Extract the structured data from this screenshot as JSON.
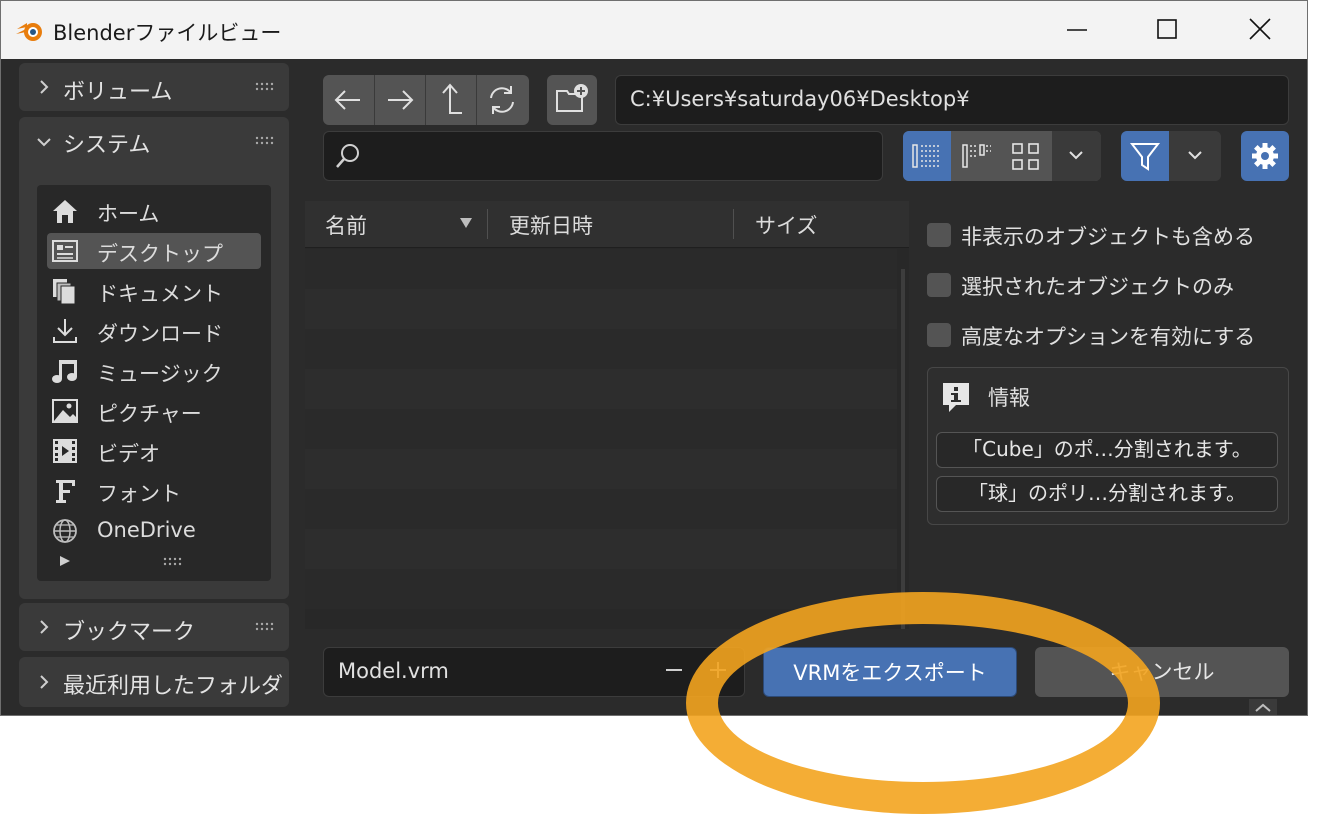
{
  "window": {
    "title": "Blenderファイルビュー"
  },
  "sidebar": {
    "volumes_label": "ボリューム",
    "system_label": "システム",
    "system_items": [
      {
        "label": "ホーム",
        "icon": "home-icon"
      },
      {
        "label": "デスクトップ",
        "icon": "desktop-icon"
      },
      {
        "label": "ドキュメント",
        "icon": "documents-icon"
      },
      {
        "label": "ダウンロード",
        "icon": "download-icon"
      },
      {
        "label": "ミュージック",
        "icon": "music-icon"
      },
      {
        "label": "ピクチャー",
        "icon": "picture-icon"
      },
      {
        "label": "ビデオ",
        "icon": "video-icon"
      },
      {
        "label": "フォント",
        "icon": "font-icon"
      },
      {
        "label": "OneDrive",
        "icon": "globe-icon"
      }
    ],
    "bookmarks_label": "ブックマーク",
    "recent_label": "最近利用したフォルダ"
  },
  "toolbar": {
    "path": "C:¥Users¥saturday06¥Desktop¥",
    "search_placeholder": ""
  },
  "file_list": {
    "columns": [
      "名前",
      "更新日時",
      "サイズ"
    ]
  },
  "options": {
    "include_hidden_label": "非表示のオブジェクトも含める",
    "selected_only_label": "選択されたオブジェクトのみ",
    "advanced_label": "高度なオプションを有効にする"
  },
  "info": {
    "title": "情報",
    "messages": [
      "「Cube」のポ…分割されます。",
      "「球」のポリ…分割されます。"
    ]
  },
  "footer": {
    "filename": "Model.vrm",
    "export_label": "VRMをエクスポート",
    "cancel_label": "キャンセル"
  },
  "colors": {
    "accent": "#4772b3",
    "highlight": "#f3a41f"
  }
}
